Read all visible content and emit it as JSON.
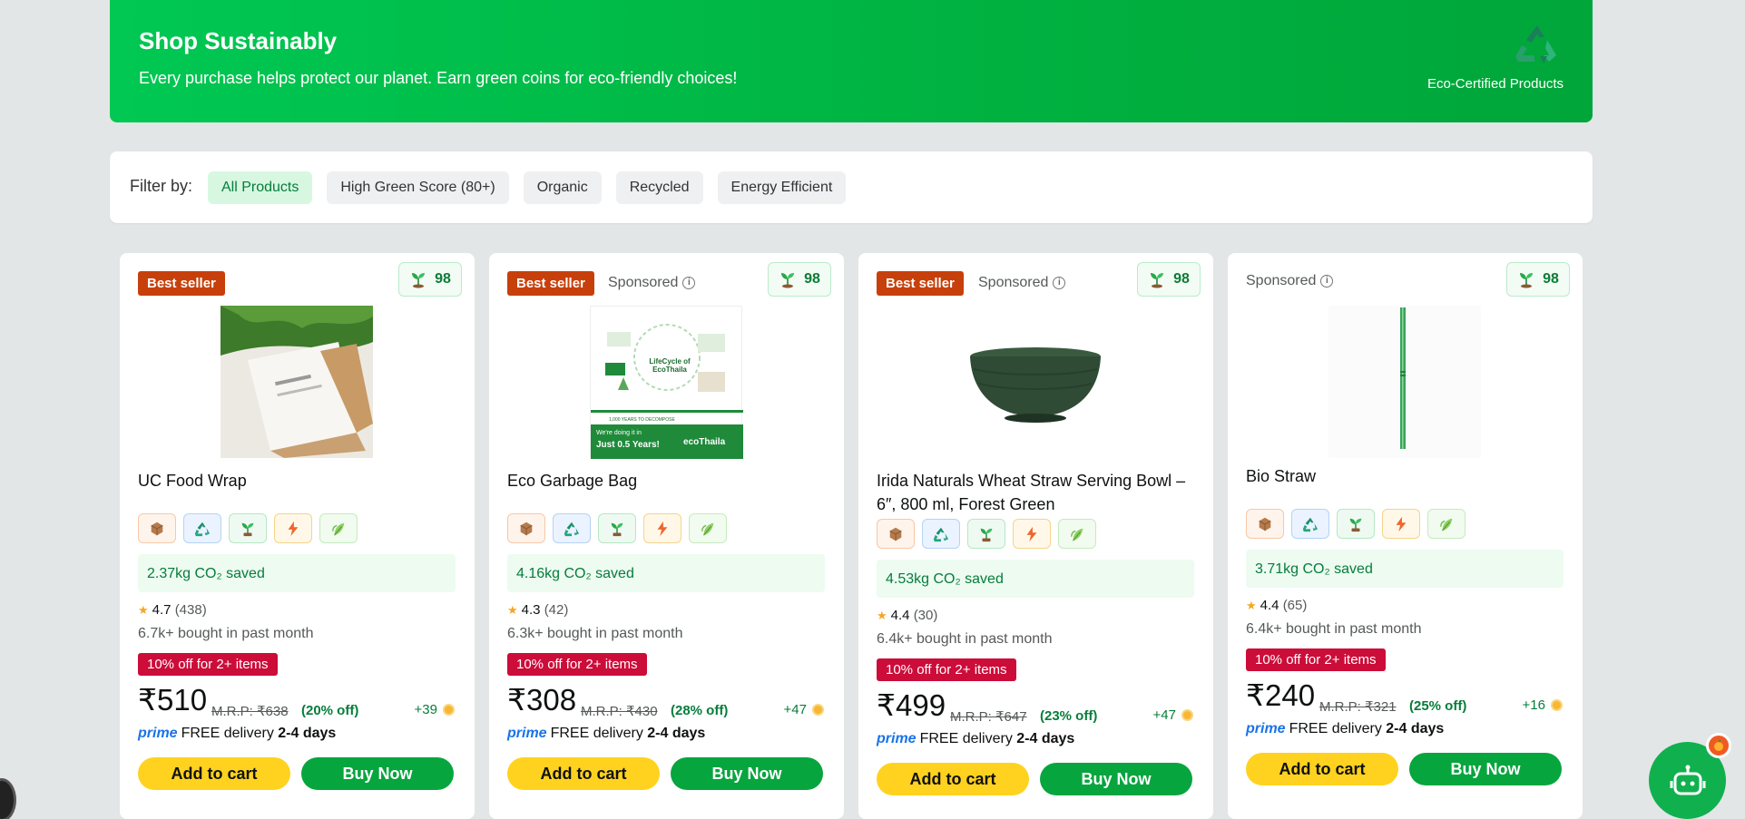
{
  "hero": {
    "title": "Shop Sustainably",
    "subtitle": "Every purchase helps protect our planet. Earn green coins for eco-friendly choices!",
    "badge_text": "Eco-Certified Products",
    "icon": "recycle-icon"
  },
  "filter": {
    "label": "Filter by:",
    "chips": [
      "All Products",
      "High Green Score (80+)",
      "Organic",
      "Recycled",
      "Energy Efficient"
    ],
    "active": "All Products"
  },
  "products": [
    {
      "badge": "Best seller",
      "sponsored": "",
      "green_score": "98",
      "title": "UC Food Wrap",
      "co2": "2.37kg CO₂ saved",
      "rating": "4.7",
      "reviews": "(438)",
      "bought": "6.7k+ bought in past month",
      "deal": "10% off for 2+ items",
      "price": "₹510",
      "mrp": "M.R.P: ₹638",
      "off": "(20% off)",
      "coins": "+39",
      "prime": "prime",
      "delivery": "FREE delivery",
      "days": "2-4 days",
      "add_to_cart": "Add to cart",
      "buy_now": "Buy Now"
    },
    {
      "badge": "Best seller",
      "sponsored": "Sponsored",
      "green_score": "98",
      "title": "Eco Garbage Bag",
      "co2": "4.16kg CO₂ saved",
      "rating": "4.3",
      "reviews": "(42)",
      "bought": "6.3k+ bought in past month",
      "deal": "10% off for 2+ items",
      "price": "₹308",
      "mrp": "M.R.P: ₹430",
      "off": "(28% off)",
      "coins": "+47",
      "prime": "prime",
      "delivery": "FREE delivery",
      "days": "2-4 days",
      "add_to_cart": "Add to cart",
      "buy_now": "Buy Now",
      "image_text": {
        "heading": "LifeCycle of EcoThaila",
        "footer1": "We're doing it in",
        "footer2": "Just 0.5 Years!",
        "brand": "ecoThaila",
        "note": "1,000 YEARS TO DECOMPOSE"
      }
    },
    {
      "badge": "Best seller",
      "sponsored": "Sponsored",
      "green_score": "98",
      "title": "Irida Naturals Wheat Straw Serving Bowl – 6″, 800 ml, Forest Green",
      "co2": "4.53kg CO₂ saved",
      "rating": "4.4",
      "reviews": "(30)",
      "bought": "6.4k+ bought in past month",
      "deal": "10% off for 2+ items",
      "price": "₹499",
      "mrp": "M.R.P: ₹647",
      "off": "(23% off)",
      "coins": "+47",
      "prime": "prime",
      "delivery": "FREE delivery",
      "days": "2-4 days",
      "add_to_cart": "Add to cart",
      "buy_now": "Buy Now"
    },
    {
      "badge": "",
      "sponsored": "Sponsored",
      "green_score": "98",
      "title": "Bio Straw",
      "co2": "3.71kg CO₂ saved",
      "rating": "4.4",
      "reviews": "(65)",
      "bought": "6.4k+ bought in past month",
      "deal": "10% off for 2+ items",
      "price": "₹240",
      "mrp": "M.R.P: ₹321",
      "off": "(25% off)",
      "coins": "+16",
      "prime": "prime",
      "delivery": "FREE delivery",
      "days": "2-4 days",
      "add_to_cart": "Add to cart",
      "buy_now": "Buy Now"
    }
  ],
  "eco_icons": [
    "box-icon",
    "recycle-icon",
    "sprout-icon",
    "bolt-icon",
    "leaf-icon"
  ],
  "colors": {
    "brand_green": "#00b140",
    "deal_red": "#cc0c39",
    "best_seller": "#c7400b",
    "cart_yellow": "#ffd21f",
    "buy_green": "#07a53e"
  },
  "assistant": {
    "icon": "robot-icon",
    "notification": "🍊"
  }
}
